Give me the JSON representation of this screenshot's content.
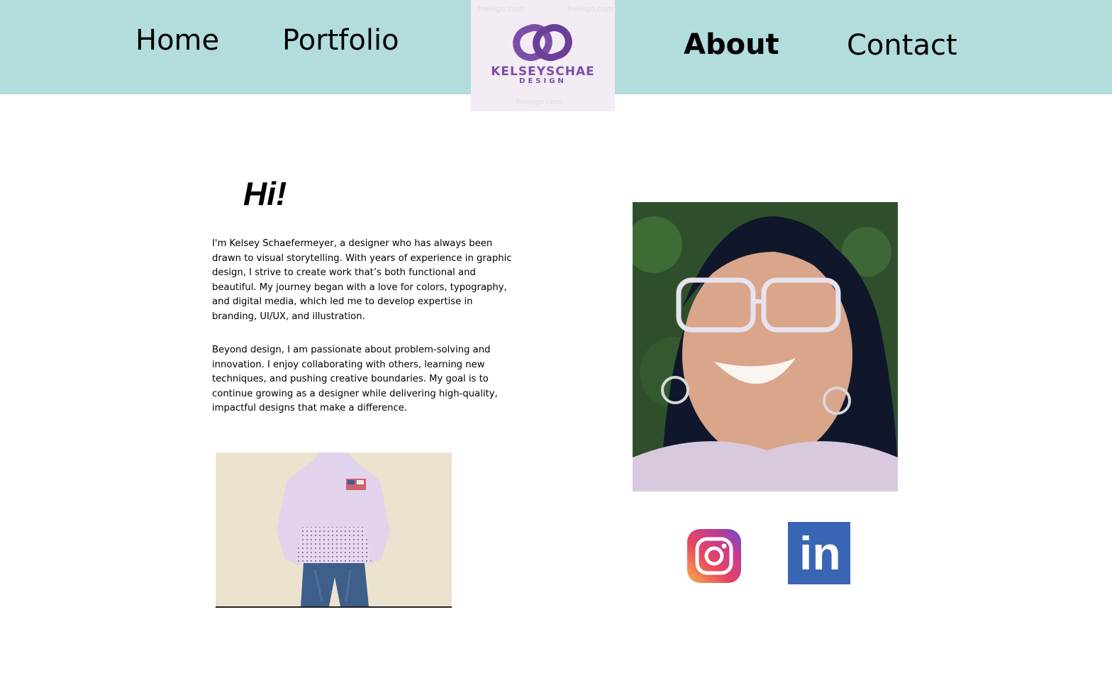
{
  "nav": {
    "home": "Home",
    "portfolio": "Portfolio",
    "about": "About",
    "contact": "Contact"
  },
  "logo": {
    "name": "KELSEYSCHAE",
    "sub": "DESIGN",
    "watermark": "freelgo.com",
    "color": "#7b4ea8"
  },
  "colors": {
    "header_bg": "#b3dcdd",
    "logo_bg": "#f3ecf4",
    "linkedin_bg": "#3965b5"
  },
  "about": {
    "greeting": "Hi!",
    "paragraph1": "I'm Kelsey Schaefermeyer, a designer who has always been drawn to visual storytelling. With years of experience in graphic design, I strive to create work that’s both functional and beautiful. My journey began with a love for colors, typography, and digital media, which led me to develop expertise in branding, UI/UX, and illustration.",
    "paragraph2": "Beyond design, I am passionate about problem-solving and innovation. I enjoy collaborating with others, learning new techniques, and pushing creative boundaries. My goal is to continue growing as a designer while delivering high-quality, impactful designs that make a difference."
  },
  "social": {
    "instagram_icon": "instagram-icon",
    "linkedin_icon": "linkedin-icon",
    "linkedin_text": "in"
  }
}
